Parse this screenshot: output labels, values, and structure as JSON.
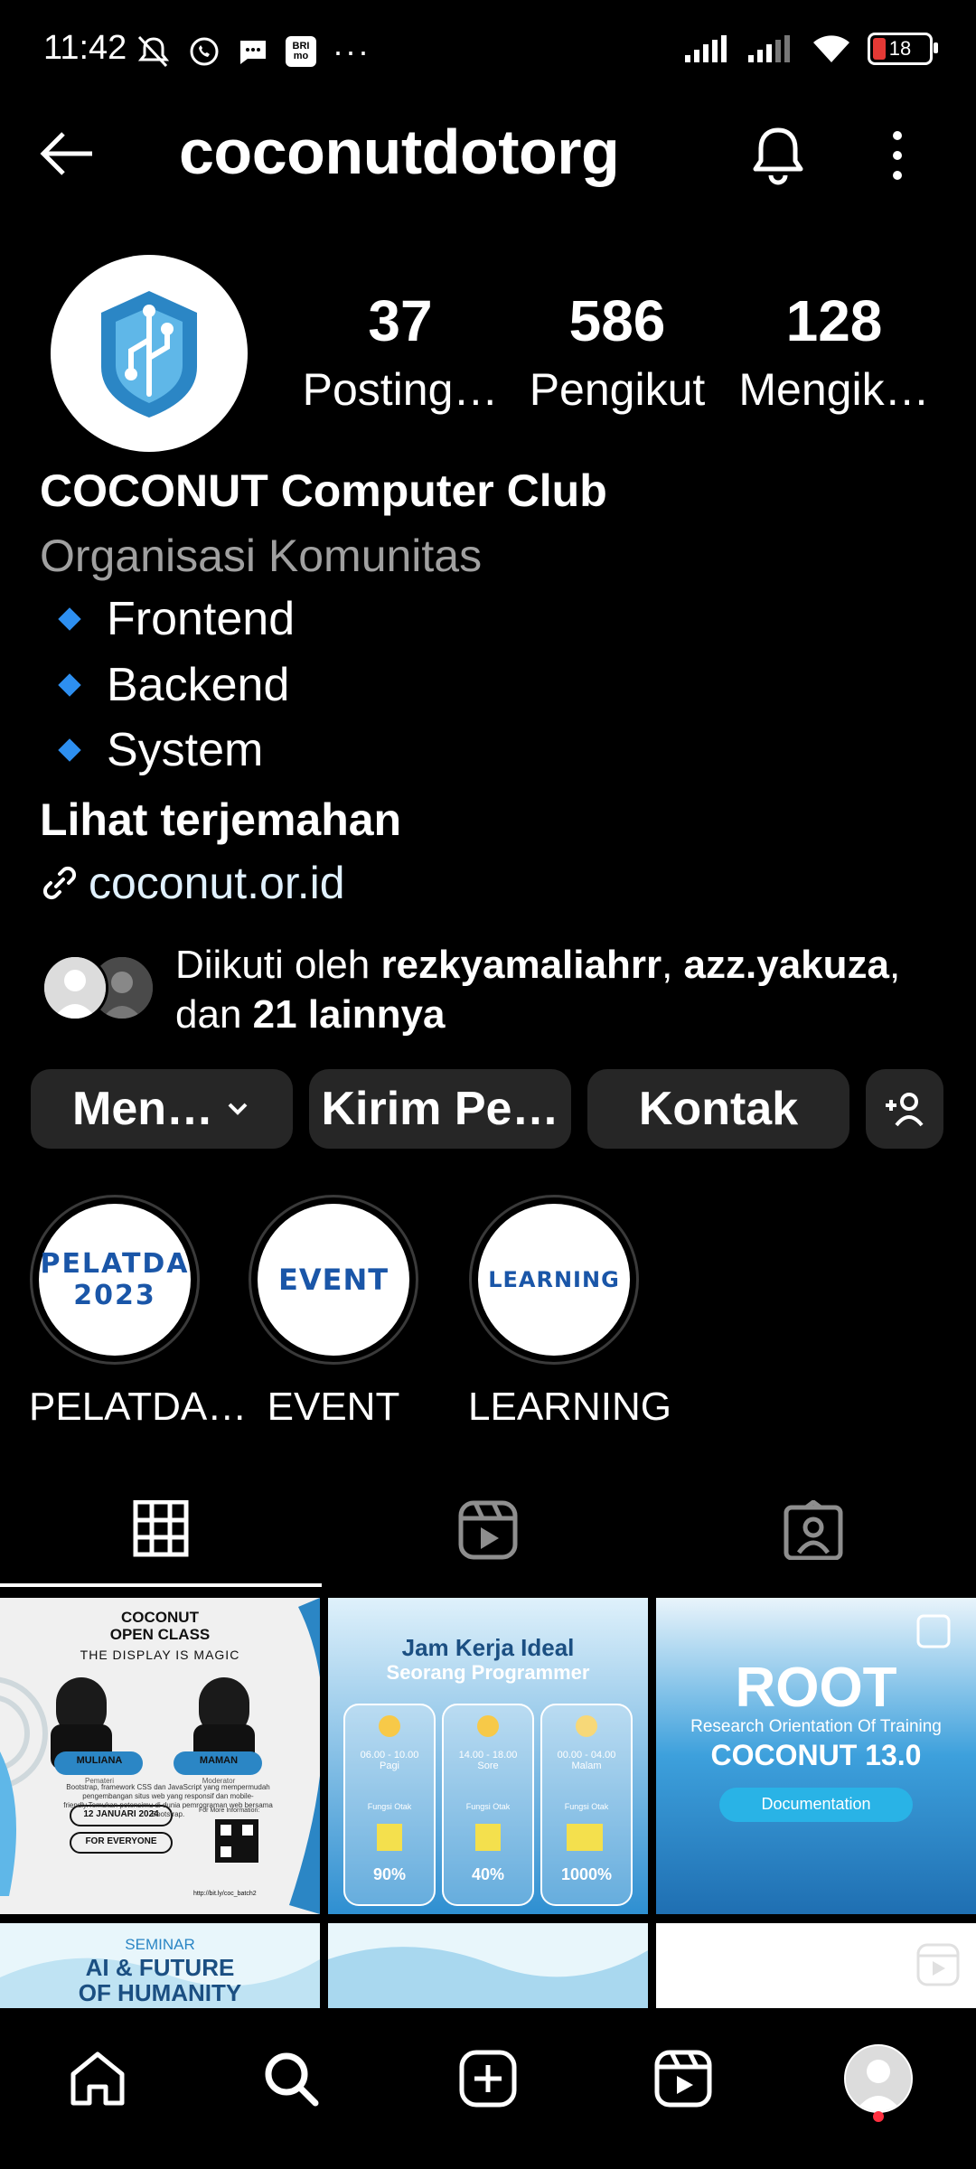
{
  "status_bar": {
    "time": "11:42",
    "bank_badge": "BRI mo",
    "battery": "18"
  },
  "header": {
    "title": "coconutdotorg"
  },
  "profile": {
    "stats": [
      {
        "value": "37",
        "label": "Posting…"
      },
      {
        "value": "586",
        "label": "Pengikut"
      },
      {
        "value": "128",
        "label": "Mengik…"
      }
    ],
    "name": "COCONUT Computer Club",
    "category": "Organisasi Komunitas",
    "bio_lines": [
      "Frontend",
      "Backend",
      "System"
    ],
    "translate": "Lihat terjemahan",
    "link": "coconut.or.id",
    "followed_by": {
      "prefix": "Diikuti oleh ",
      "user1": "rezkyamaliahrr",
      "sep": ", ",
      "user2": "azz.yakuza",
      "suffix1": ",",
      "line2_prefix": "dan ",
      "others": "21 lainnya"
    }
  },
  "buttons": {
    "following": "Men…",
    "message": "Kirim Pe…",
    "contact": "Kontak"
  },
  "highlights": [
    {
      "label": "PELATDA…",
      "cover_line1": "PELATDA",
      "cover_line2": "2023"
    },
    {
      "label": "EVENT",
      "cover_line1": "EVENT"
    },
    {
      "label": "LEARNING",
      "cover_line1": "LEARNING"
    }
  ],
  "posts": {
    "post1": {
      "title1": "COCONUT",
      "title2": "OPEN CLASS",
      "subtitle": "THE DISPLAY IS MAGIC",
      "person1": "MULIANA",
      "person1_role": "Pemateri",
      "person2": "MAMAN",
      "person2_role": "Moderator",
      "desc": "Bootstrap, framework CSS dan JavaScript yang mempermudah pengembangan situs web yang responsif dan mobile-friendly.Temukan potensimu di dunia pemrograman web bersama Bootstrap.",
      "date": "12 JANUARI 2024",
      "audience": "FOR EVERYONE",
      "more_info": "For More Information:",
      "url": "http://bit.ly/coc_batch2"
    },
    "post2": {
      "title1": "Jam Kerja Ideal",
      "title2": "Seorang Programmer",
      "cols": [
        {
          "time": "06.00 - 10.00",
          "period": "Pagi",
          "label": "Fungsi Otak",
          "value": "90%"
        },
        {
          "time": "14.00 - 18.00",
          "period": "Sore",
          "label": "Fungsi Otak",
          "value": "40%"
        },
        {
          "time": "00.00 - 04.00",
          "period": "Malam",
          "label": "Fungsi Otak",
          "value": "1000%"
        }
      ]
    },
    "post3": {
      "title": "ROOT",
      "subtitle": "Research Orientation Of Training",
      "event": "COCONUT 13.0",
      "button": "Documentation"
    },
    "post4": {
      "line1": "SEMINAR",
      "line2": "AI & FUTURE",
      "line3": "OF HUMANITY"
    }
  },
  "colors": {
    "background": "#000000",
    "button_bg": "#262626",
    "link": "#e0f1ff",
    "muted": "#a0a0a0",
    "accent_blue": "#2d8ff0",
    "notification_dot": "#ff3040"
  }
}
